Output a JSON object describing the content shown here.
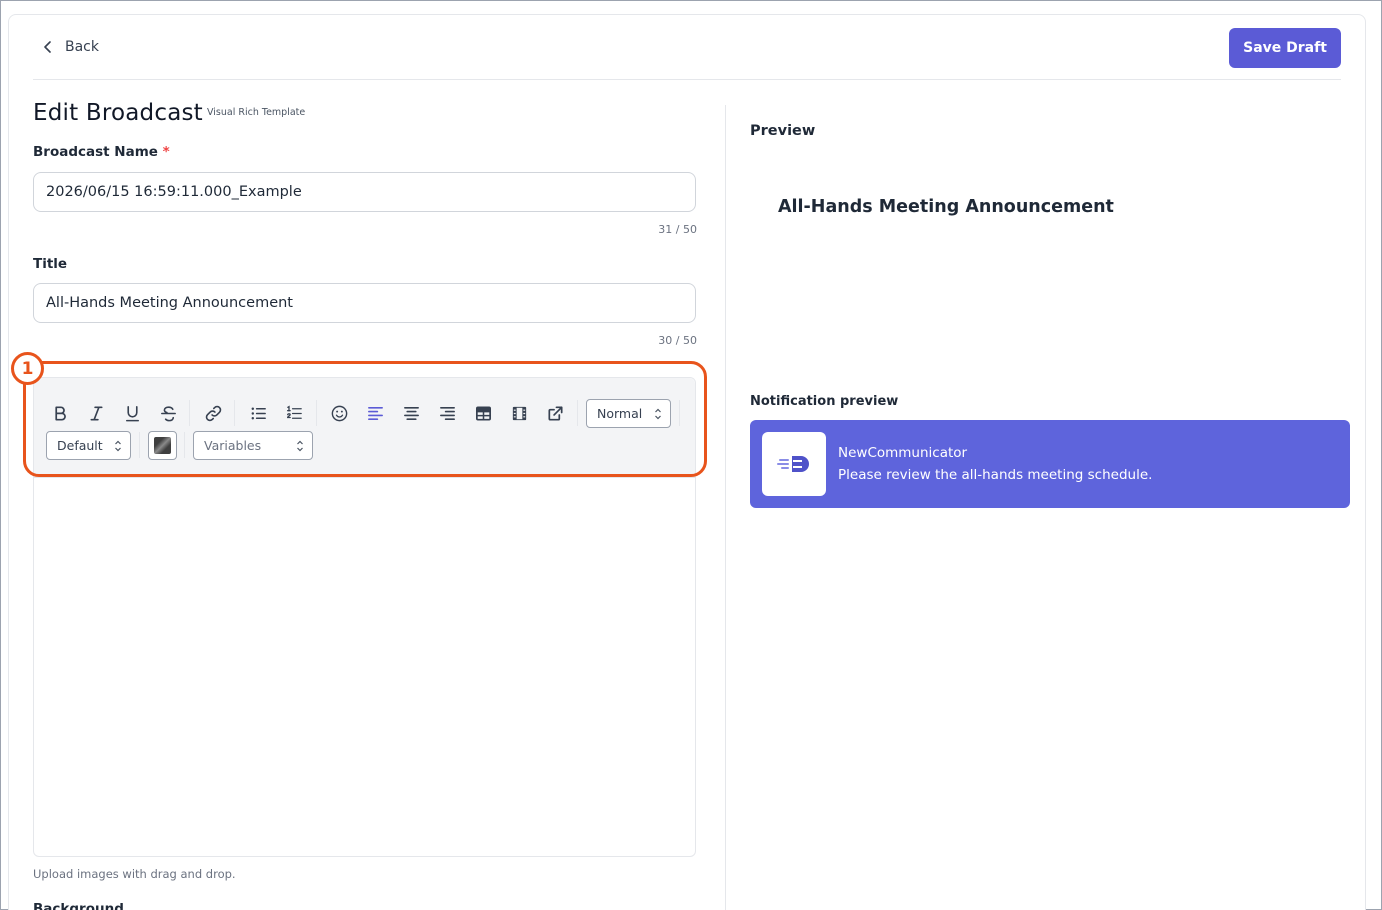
{
  "header": {
    "back_label": "Back",
    "save_label": "Save Draft",
    "accent_color": "#5b5bd6"
  },
  "form": {
    "page_title": "Edit Broadcast",
    "template_tag": "Visual Rich Template",
    "broadcast_name": {
      "label": "Broadcast Name",
      "required_mark": "*",
      "value": "2026/06/15 16:59:11.000_Example",
      "counter": "31 / 50"
    },
    "title": {
      "label": "Title",
      "value": "All-Hands Meeting Announcement",
      "counter": "30 / 50"
    },
    "toolbar": {
      "buttons": [
        "bold-icon",
        "italic-icon",
        "underline-icon",
        "strikethrough-icon",
        "link-icon",
        "bullet-list-icon",
        "numbered-list-icon",
        "emoji-icon",
        "align-left-icon",
        "align-center-icon",
        "align-right-icon",
        "table-icon",
        "video-icon",
        "external-link-icon"
      ],
      "size_select": "Normal",
      "font_select": "Default",
      "variables_select": "Variables"
    },
    "annotation_marker": "1",
    "annotation_color": "#e8541c",
    "upload_hint": "Upload images with drag and drop.",
    "background_label": "Background"
  },
  "preview": {
    "heading": "Preview",
    "title": "All-Hands Meeting Announcement",
    "notification_heading": "Notification preview",
    "notification": {
      "app_name": "NewCommunicator",
      "message": "Please review the all-hands meeting schedule.",
      "background_color": "#5e64dc"
    }
  }
}
